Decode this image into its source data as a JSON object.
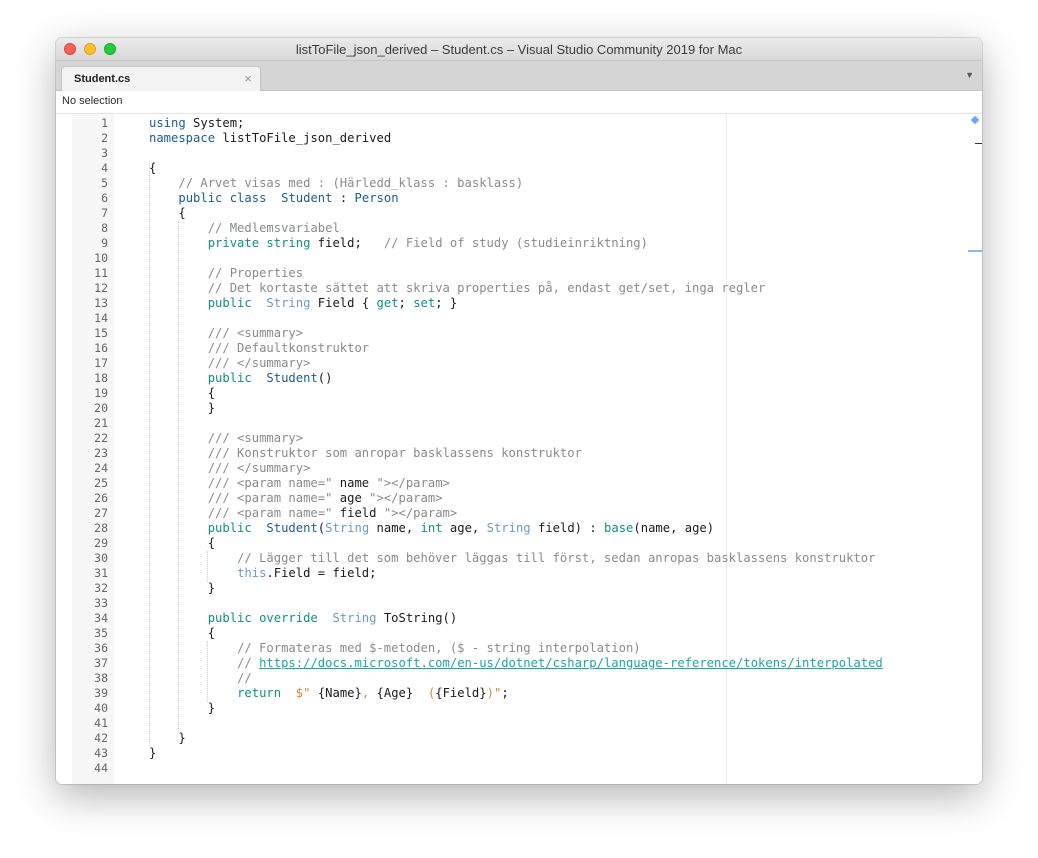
{
  "window": {
    "title": "listToFile_json_derived – Student.cs – Visual Studio Community 2019 for Mac"
  },
  "tabs": [
    {
      "label": "Student.cs",
      "close": "×",
      "active": true
    }
  ],
  "tab_dropdown_glyph": "▼",
  "navbar": {
    "selection_text": "No selection"
  },
  "colors": {
    "keyword": "#1c5c8f",
    "type": "#6b9ac4",
    "accessor": "#0e8f82",
    "comment": "#8a8a8a",
    "string": "#d08a35",
    "link": "#1aa6a0"
  },
  "code_lines": [
    {
      "n": "1",
      "parts": [
        [
          "kw",
          "using"
        ],
        [
          "",
          "System;"
        ]
      ]
    },
    {
      "n": "2",
      "parts": [
        [
          "kw",
          "namespace"
        ],
        [
          "",
          "listToFile_json_derived"
        ]
      ]
    },
    {
      "n": "3",
      "parts": []
    },
    {
      "n": "4",
      "parts": [
        [
          "",
          "{"
        ]
      ]
    },
    {
      "n": "5",
      "parts": [
        [
          "",
          "    "
        ],
        [
          "cm",
          "// Arvet visas med : (Härledd_klass : basklass)"
        ]
      ]
    },
    {
      "n": "6",
      "parts": [
        [
          "",
          "    "
        ],
        [
          "kw",
          "public class"
        ],
        [
          "",
          ""
        ],
        [
          "kw",
          "Student"
        ],
        [
          "",
          ":"
        ],
        [
          "kw",
          "Person"
        ]
      ]
    },
    {
      "n": "7",
      "parts": [
        [
          "",
          "    {"
        ]
      ]
    },
    {
      "n": "8",
      "parts": [
        [
          "",
          "        "
        ],
        [
          "cm",
          "// Medlemsvariabel"
        ]
      ]
    },
    {
      "n": "9",
      "parts": [
        [
          "",
          "        "
        ],
        [
          "acc",
          "private string"
        ],
        [
          "",
          "field;   "
        ],
        [
          "cm",
          "// Field of study (studieinriktning)"
        ]
      ]
    },
    {
      "n": "10",
      "parts": []
    },
    {
      "n": "11",
      "parts": [
        [
          "",
          "        "
        ],
        [
          "cm",
          "// Properties"
        ]
      ]
    },
    {
      "n": "12",
      "parts": [
        [
          "",
          "        "
        ],
        [
          "cm",
          "// Det kortaste sättet att skriva properties på, endast get/set, inga regler"
        ]
      ]
    },
    {
      "n": "13",
      "parts": [
        [
          "",
          "        "
        ],
        [
          "acc",
          "public"
        ],
        [
          "",
          ""
        ],
        [
          "type",
          "String"
        ],
        [
          "",
          "Field {"
        ],
        [
          "acc",
          "get"
        ],
        [
          "",
          "; "
        ],
        [
          "acc",
          "set"
        ],
        [
          "",
          "; }"
        ]
      ]
    },
    {
      "n": "14",
      "parts": []
    },
    {
      "n": "15",
      "parts": [
        [
          "",
          "        "
        ],
        [
          "cm",
          "/// <summary>"
        ]
      ]
    },
    {
      "n": "16",
      "parts": [
        [
          "",
          "        "
        ],
        [
          "cm",
          "/// Defaultkonstruktor"
        ]
      ]
    },
    {
      "n": "17",
      "parts": [
        [
          "",
          "        "
        ],
        [
          "cm",
          "/// </summary>"
        ]
      ]
    },
    {
      "n": "18",
      "parts": [
        [
          "",
          "        "
        ],
        [
          "acc",
          "public"
        ],
        [
          "",
          ""
        ],
        [
          "kw",
          "Student"
        ],
        [
          "",
          "()"
        ]
      ]
    },
    {
      "n": "19",
      "parts": [
        [
          "",
          "        {"
        ]
      ]
    },
    {
      "n": "20",
      "parts": [
        [
          "",
          "        }"
        ]
      ]
    },
    {
      "n": "21",
      "parts": []
    },
    {
      "n": "22",
      "parts": [
        [
          "",
          "        "
        ],
        [
          "cm",
          "/// <summary>"
        ]
      ]
    },
    {
      "n": "23",
      "parts": [
        [
          "",
          "        "
        ],
        [
          "cm",
          "/// Konstruktor som anropar basklassens konstruktor"
        ]
      ]
    },
    {
      "n": "24",
      "parts": [
        [
          "",
          "        "
        ],
        [
          "cm",
          "/// </summary>"
        ]
      ]
    },
    {
      "n": "25",
      "parts": [
        [
          "",
          "        "
        ],
        [
          "cm",
          "/// <param name=\""
        ],
        [
          "",
          "name"
        ],
        [
          "cm",
          "\"></param>"
        ]
      ]
    },
    {
      "n": "26",
      "parts": [
        [
          "",
          "        "
        ],
        [
          "cm",
          "/// <param name=\""
        ],
        [
          "",
          "age"
        ],
        [
          "cm",
          "\"></param>"
        ]
      ]
    },
    {
      "n": "27",
      "parts": [
        [
          "",
          "        "
        ],
        [
          "cm",
          "/// <param name=\""
        ],
        [
          "",
          "field"
        ],
        [
          "cm",
          "\"></param>"
        ]
      ]
    },
    {
      "n": "28",
      "parts": [
        [
          "",
          "        "
        ],
        [
          "acc",
          "public"
        ],
        [
          "",
          ""
        ],
        [
          "kw",
          "Student"
        ],
        [
          "",
          "("
        ],
        [
          "type",
          "String"
        ],
        [
          "",
          "name,"
        ],
        [
          "acc",
          "int"
        ],
        [
          "",
          "age,"
        ],
        [
          "type",
          "String"
        ],
        [
          "",
          "field) :"
        ],
        [
          "acc",
          "base"
        ],
        [
          "",
          "(name, age)"
        ]
      ]
    },
    {
      "n": "29",
      "parts": [
        [
          "",
          "        {"
        ]
      ]
    },
    {
      "n": "30",
      "parts": [
        [
          "",
          "            "
        ],
        [
          "cm",
          "// Lägger till det som behöver läggas till först, sedan anropas basklassens konstruktor"
        ]
      ]
    },
    {
      "n": "31",
      "parts": [
        [
          "",
          "            "
        ],
        [
          "type",
          "this"
        ],
        [
          "",
          ".Field = field;"
        ]
      ]
    },
    {
      "n": "32",
      "parts": [
        [
          "",
          "        }"
        ]
      ]
    },
    {
      "n": "33",
      "parts": []
    },
    {
      "n": "34",
      "parts": [
        [
          "",
          "        "
        ],
        [
          "acc",
          "public override"
        ],
        [
          "",
          ""
        ],
        [
          "type",
          "String"
        ],
        [
          "",
          "ToString()"
        ]
      ]
    },
    {
      "n": "35",
      "parts": [
        [
          "",
          "        {"
        ]
      ]
    },
    {
      "n": "36",
      "parts": [
        [
          "",
          "            "
        ],
        [
          "cm",
          "// Formateras med $-metoden, ($ - string interpolation)"
        ]
      ]
    },
    {
      "n": "37",
      "parts": [
        [
          "",
          "            "
        ],
        [
          "cm",
          "// "
        ],
        [
          "lnk",
          "https://docs.microsoft.com/en-us/dotnet/csharp/language-reference/tokens/interpolated"
        ]
      ]
    },
    {
      "n": "38",
      "parts": [
        [
          "",
          "            "
        ],
        [
          "cm",
          "//"
        ]
      ]
    },
    {
      "n": "39",
      "parts": [
        [
          "",
          "            "
        ],
        [
          "acc",
          "return"
        ],
        [
          "",
          ""
        ],
        [
          "str",
          "$\""
        ],
        [
          "",
          "{Name}"
        ],
        [
          "str",
          ", "
        ],
        [
          "",
          "{Age}"
        ],
        [
          "str",
          " ("
        ],
        [
          "",
          "{Field}"
        ],
        [
          "str",
          ")\""
        ],
        [
          "",
          ";"
        ]
      ]
    },
    {
      "n": "40",
      "parts": [
        [
          "",
          "        }"
        ]
      ]
    },
    {
      "n": "41",
      "parts": []
    },
    {
      "n": "42",
      "parts": [
        [
          "",
          "    }"
        ]
      ]
    },
    {
      "n": "43",
      "parts": [
        [
          "",
          "}"
        ]
      ]
    },
    {
      "n": "44",
      "parts": []
    }
  ]
}
